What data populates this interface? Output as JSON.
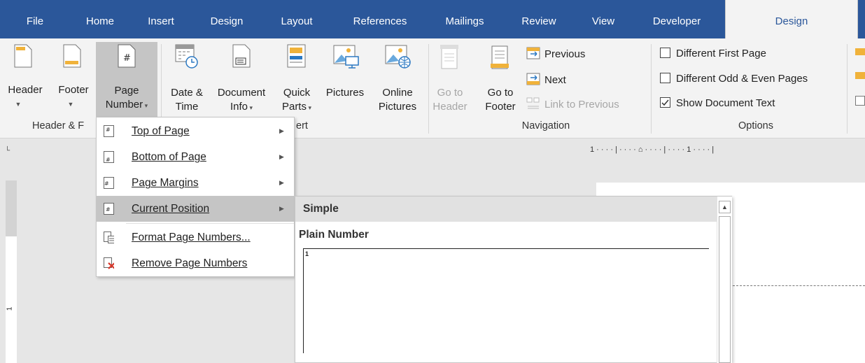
{
  "tabs": [
    "File",
    "Home",
    "Insert",
    "Design",
    "Layout",
    "References",
    "Mailings",
    "Review",
    "View",
    "Developer",
    "Design"
  ],
  "ribbon": {
    "header_label": "Header",
    "footer_label": "Footer",
    "page_number_line1": "Page",
    "page_number_line2": "Number",
    "date_line1": "Date &",
    "date_line2": "Time",
    "docinfo_line1": "Document",
    "docinfo_line2": "Info",
    "quickparts_line1": "Quick",
    "quickparts_line2": "Parts",
    "pictures_label": "Pictures",
    "online_line1": "Online",
    "online_line2": "Pictures",
    "gotoheader_line1": "Go to",
    "gotoheader_line2": "Header",
    "gotofooter_line1": "Go to",
    "gotofooter_line2": "Footer",
    "previous_label": "Previous",
    "next_label": "Next",
    "link_previous_label": "Link to Previous",
    "different_first_page": "Different First Page",
    "different_odd_even": "Different Odd & Even Pages",
    "show_document_text": "Show Document Text",
    "group_header_footer": "Header & F",
    "group_insert_tail": "ert",
    "group_navigation": "Navigation",
    "group_options": "Options"
  },
  "options": {
    "different_first_page_checked": false,
    "different_odd_even_checked": false,
    "show_document_text_checked": true
  },
  "ruler": {
    "top": "1 · · · · | · · · · ⌂ · · · · | · · · · 1 · · · · |",
    "left_marker": "1"
  },
  "menu": {
    "items": [
      {
        "label": "Top of Page",
        "icon": "page-top-icon"
      },
      {
        "label": "Bottom of Page",
        "icon": "page-bottom-icon"
      },
      {
        "label": "Page Margins",
        "icon": "page-margins-icon"
      },
      {
        "label": "Current Position",
        "icon": "current-position-icon"
      },
      {
        "label": "Format Page Numbers...",
        "icon": "format-page-numbers-icon"
      },
      {
        "label": "Remove Page Numbers",
        "icon": "remove-page-numbers-icon"
      }
    ]
  },
  "gallery": {
    "section": "Simple",
    "item_title": "Plain Number",
    "preview_number": "1"
  },
  "colors": {
    "tab_bar": "#2b579a",
    "ribbon_bg": "#f3f3f3",
    "hover": "#c5c5c5",
    "remove_red": "#d8372a"
  }
}
